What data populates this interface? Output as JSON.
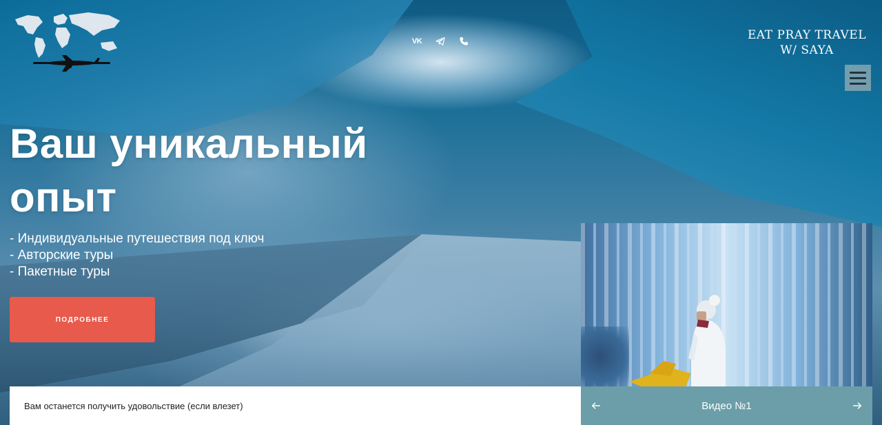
{
  "header": {
    "socials": [
      {
        "icon": "vk-icon",
        "label": "VK"
      },
      {
        "icon": "telegram-icon",
        "label": ""
      },
      {
        "icon": "phone-icon",
        "label": ""
      }
    ],
    "brand_line1": "EAT PRAY TRAVEL",
    "brand_line2": "W/ SAYA"
  },
  "hero": {
    "headline": "Ваш уникальный опыт",
    "bullets": [
      "- Индивидуальные путешествия под ключ",
      "- Авторские туры",
      "- Пакетные туры"
    ],
    "cta_label": "ПОДРОБНЕЕ"
  },
  "footer": {
    "caption": "Вам останется получить удовольствие (если влезет)",
    "video_title": "Видео №1"
  },
  "colors": {
    "accent": "#e85a4b",
    "video_bar": "#6b9ea8",
    "menu_button": "#96afb4"
  }
}
